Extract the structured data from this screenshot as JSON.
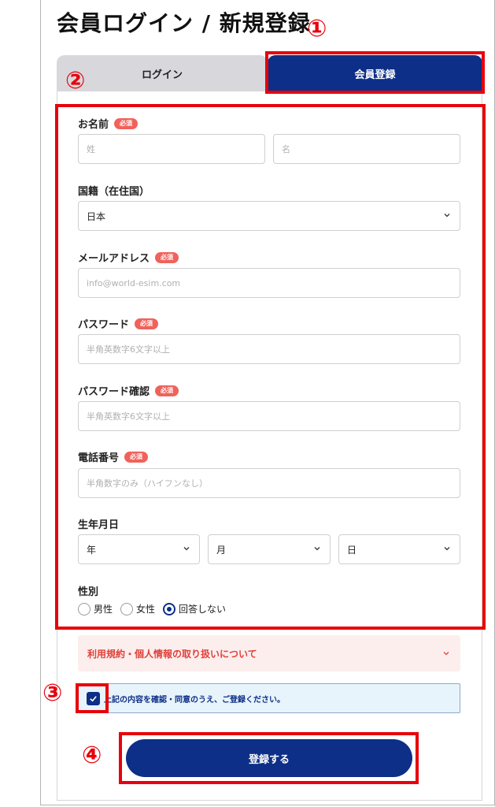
{
  "page": {
    "title": "会員ログイン / 新規登録"
  },
  "markers": [
    "①",
    "②",
    "③",
    "④"
  ],
  "tabs": {
    "login": "ログイン",
    "register": "会員登録"
  },
  "form": {
    "required": "必須",
    "name": {
      "label": "お名前",
      "last_placeholder": "姓",
      "first_placeholder": "名"
    },
    "country": {
      "label": "国籍（在住国）",
      "value": "日本"
    },
    "email": {
      "label": "メールアドレス",
      "placeholder": "info@world-esim.com"
    },
    "password": {
      "label": "パスワード",
      "placeholder": "半角英数字6文字以上"
    },
    "password_confirm": {
      "label": "パスワード確認",
      "placeholder": "半角英数字6文字以上"
    },
    "phone": {
      "label": "電話番号",
      "placeholder": "半角数字のみ（ハイフンなし）"
    },
    "birthday": {
      "label": "生年月日",
      "year": "年",
      "month": "月",
      "day": "日"
    },
    "gender": {
      "label": "性別",
      "options": [
        "男性",
        "女性",
        "回答しない"
      ],
      "selected": 2
    },
    "terms": "利用規約・個人情報の取り扱いについて",
    "agree": "上記の内容を確認・同意のうえ、ご登録ください。",
    "submit": "登録する"
  },
  "colors": {
    "primary": "#0d2f87",
    "accent_red": "#e8000b",
    "required_badge": "#f0625b"
  },
  "icons": [
    "chevron-down-icon",
    "checkmark-icon",
    "radio-icon"
  ]
}
